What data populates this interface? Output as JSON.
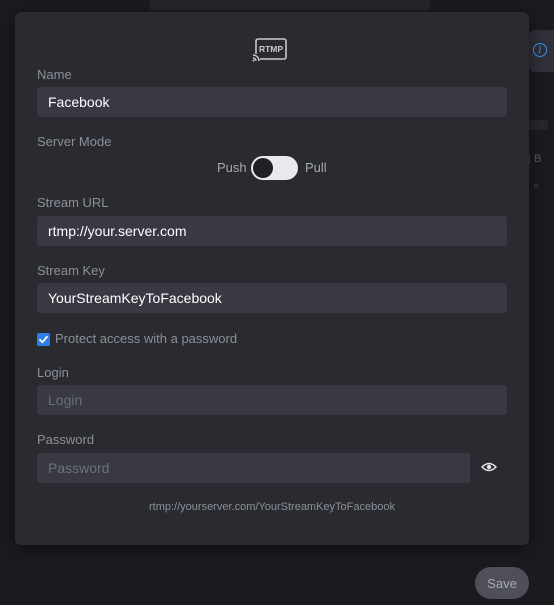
{
  "logo": {
    "text": "RTMP"
  },
  "name": {
    "label": "Name",
    "value": "Facebook"
  },
  "server_mode": {
    "label": "Server Mode",
    "push_label": "Push",
    "pull_label": "Pull",
    "selected": "Push"
  },
  "stream_url": {
    "label": "Stream URL",
    "value": "rtmp://your.server.com"
  },
  "stream_key": {
    "label": "Stream Key",
    "value": "YourStreamKeyToFacebook"
  },
  "protect": {
    "label": "Protect access with a password",
    "checked": true
  },
  "login": {
    "label": "Login",
    "placeholder": "Login",
    "value": ""
  },
  "password": {
    "label": "Password",
    "placeholder": "Password",
    "value": ""
  },
  "full_url": "rtmp://yourserver.com/YourStreamKeyToFacebook",
  "save_label": "Save",
  "colors": {
    "accent": "#2f7fe8",
    "panel": "#2a2b31",
    "field": "#383942",
    "info": "#3b8ff0"
  }
}
